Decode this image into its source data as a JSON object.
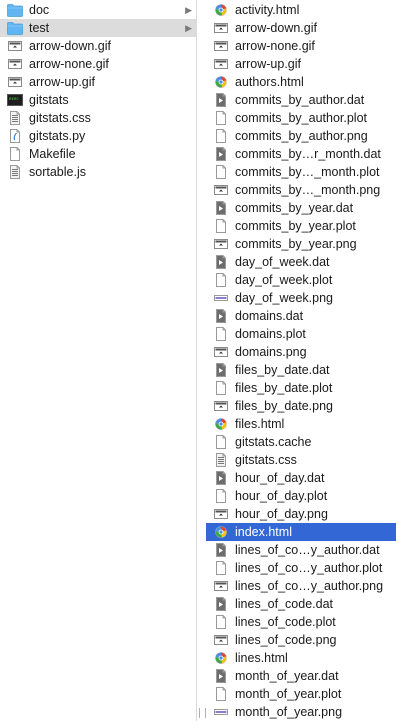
{
  "left_column": {
    "items": [
      {
        "name": "doc",
        "icon": "folder-icon",
        "has_children": true,
        "selected": false
      },
      {
        "name": "test",
        "icon": "folder-icon",
        "has_children": true,
        "selected": true
      },
      {
        "name": "arrow-down.gif",
        "icon": "image-file-icon",
        "has_children": false,
        "selected": false
      },
      {
        "name": "arrow-none.gif",
        "icon": "image-file-icon",
        "has_children": false,
        "selected": false
      },
      {
        "name": "arrow-up.gif",
        "icon": "image-file-icon",
        "has_children": false,
        "selected": false
      },
      {
        "name": "gitstats",
        "icon": "terminal-executable-icon",
        "has_children": false,
        "selected": false
      },
      {
        "name": "gitstats.css",
        "icon": "css-file-icon",
        "has_children": false,
        "selected": false
      },
      {
        "name": "gitstats.py",
        "icon": "python-file-icon",
        "has_children": false,
        "selected": false
      },
      {
        "name": "Makefile",
        "icon": "document-icon",
        "has_children": false,
        "selected": false
      },
      {
        "name": "sortable.js",
        "icon": "css-file-icon",
        "has_children": false,
        "selected": false
      }
    ]
  },
  "right_column": {
    "items": [
      {
        "name": "activity.html",
        "icon": "html-file-icon"
      },
      {
        "name": "arrow-down.gif",
        "icon": "image-file-icon"
      },
      {
        "name": "arrow-none.gif",
        "icon": "image-file-icon"
      },
      {
        "name": "arrow-up.gif",
        "icon": "image-file-icon"
      },
      {
        "name": "authors.html",
        "icon": "html-file-icon"
      },
      {
        "name": "commits_by_author.dat",
        "icon": "data-file-icon"
      },
      {
        "name": "commits_by_author.plot",
        "icon": "document-icon"
      },
      {
        "name": "commits_by_author.png",
        "icon": "document-icon"
      },
      {
        "name": "commits_by…r_month.dat",
        "icon": "data-file-icon"
      },
      {
        "name": "commits_by…_month.plot",
        "icon": "document-icon"
      },
      {
        "name": "commits_by…_month.png",
        "icon": "image-file-icon"
      },
      {
        "name": "commits_by_year.dat",
        "icon": "data-file-icon"
      },
      {
        "name": "commits_by_year.plot",
        "icon": "document-icon"
      },
      {
        "name": "commits_by_year.png",
        "icon": "image-file-icon"
      },
      {
        "name": "day_of_week.dat",
        "icon": "data-file-icon"
      },
      {
        "name": "day_of_week.plot",
        "icon": "document-icon"
      },
      {
        "name": "day_of_week.png",
        "icon": "image-file-purple-icon"
      },
      {
        "name": "domains.dat",
        "icon": "data-file-icon"
      },
      {
        "name": "domains.plot",
        "icon": "document-icon"
      },
      {
        "name": "domains.png",
        "icon": "image-file-icon"
      },
      {
        "name": "files_by_date.dat",
        "icon": "data-file-icon"
      },
      {
        "name": "files_by_date.plot",
        "icon": "document-icon"
      },
      {
        "name": "files_by_date.png",
        "icon": "image-file-icon"
      },
      {
        "name": "files.html",
        "icon": "html-file-icon"
      },
      {
        "name": "gitstats.cache",
        "icon": "document-icon"
      },
      {
        "name": "gitstats.css",
        "icon": "css-file-icon"
      },
      {
        "name": "hour_of_day.dat",
        "icon": "data-file-icon"
      },
      {
        "name": "hour_of_day.plot",
        "icon": "document-icon"
      },
      {
        "name": "hour_of_day.png",
        "icon": "image-file-icon"
      },
      {
        "name": "index.html",
        "icon": "html-file-icon",
        "selected": true
      },
      {
        "name": "lines_of_co…y_author.dat",
        "icon": "data-file-icon"
      },
      {
        "name": "lines_of_co…y_author.plot",
        "icon": "document-icon"
      },
      {
        "name": "lines_of_co…y_author.png",
        "icon": "image-file-icon"
      },
      {
        "name": "lines_of_code.dat",
        "icon": "data-file-icon"
      },
      {
        "name": "lines_of_code.plot",
        "icon": "document-icon"
      },
      {
        "name": "lines_of_code.png",
        "icon": "image-file-icon"
      },
      {
        "name": "lines.html",
        "icon": "html-file-icon"
      },
      {
        "name": "month_of_year.dat",
        "icon": "data-file-icon"
      },
      {
        "name": "month_of_year.plot",
        "icon": "document-icon"
      },
      {
        "name": "month_of_year.png",
        "icon": "image-file-purple-icon"
      }
    ]
  },
  "colors": {
    "selection_blue": "#3467d6",
    "selection_gray": "#dcdcdc",
    "folder_blue": "#5fb6f2"
  }
}
